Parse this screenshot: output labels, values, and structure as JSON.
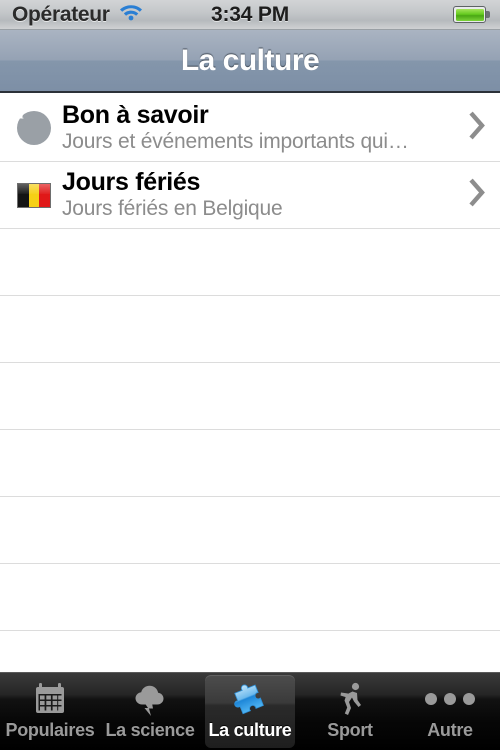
{
  "status_bar": {
    "carrier": "Opérateur",
    "wifi_icon": "wifi-icon",
    "time": "3:34 PM",
    "battery_icon": "battery-icon"
  },
  "nav_bar": {
    "title": "La culture"
  },
  "table": {
    "rows": [
      {
        "icon": "info-circle-icon",
        "title": "Bon à savoir",
        "subtitle": "Jours et événements importants qui…",
        "accessory": "chevron-right-icon"
      },
      {
        "icon": "belgium-flag-icon",
        "title": "Jours fériés",
        "subtitle": "Jours fériés en Belgique",
        "accessory": "chevron-right-icon"
      }
    ],
    "empty_row_count": 7
  },
  "tab_bar": {
    "tabs": [
      {
        "label": "Populaires",
        "icon": "calendar-icon",
        "active": false
      },
      {
        "label": "La science",
        "icon": "cloud-lightning-icon",
        "active": false
      },
      {
        "label": "La culture",
        "icon": "puzzle-piece-icon",
        "active": true
      },
      {
        "label": "Sport",
        "icon": "running-person-icon",
        "active": false
      },
      {
        "label": "Autre",
        "icon": "more-dots-icon",
        "active": false
      }
    ]
  },
  "colors": {
    "nav_bar_top": "#aab4c2",
    "nav_bar_bottom": "#7d8fa6",
    "active_tab_icon": "#3aa6e8",
    "inactive_tab_icon": "#9a9a9a",
    "subtitle_text": "#8c8c8c",
    "battery_fill": "#63c91e",
    "wifi": "#2a7fd4"
  }
}
